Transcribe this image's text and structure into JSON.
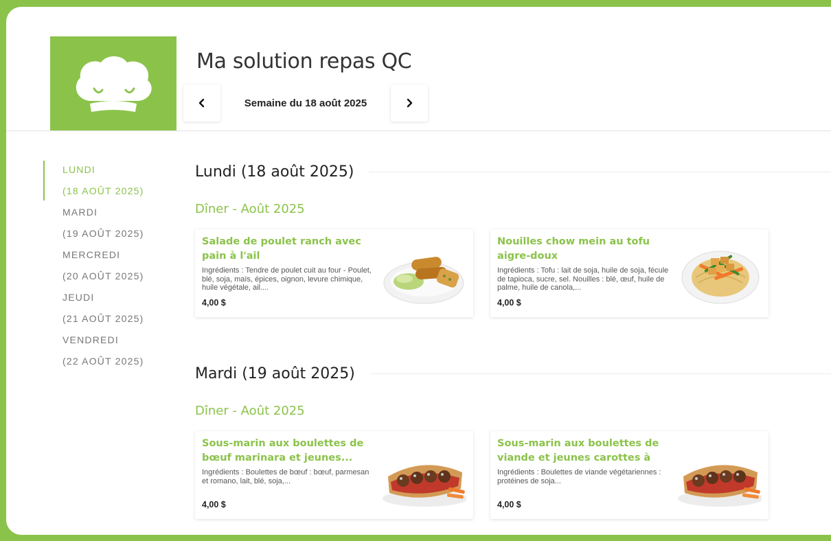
{
  "app": {
    "title": "Ma solution repas QC",
    "logo_icon": "chef-hat-icon"
  },
  "week_nav": {
    "label": "Semaine du 18 août 2025",
    "prev_icon": "chevron-left-icon",
    "next_icon": "chevron-right-icon"
  },
  "sidebar": {
    "items": [
      {
        "day": "LUNDI",
        "date": "(18 AOÛT 2025)",
        "active": true
      },
      {
        "day": "MARDI",
        "date": "(19 AOÛT 2025)",
        "active": false
      },
      {
        "day": "MERCREDI",
        "date": "(20 AOÛT 2025)",
        "active": false
      },
      {
        "day": "JEUDI",
        "date": "(21 AOÛT 2025)",
        "active": false
      },
      {
        "day": "VENDREDI",
        "date": "(22 AOÛT 2025)",
        "active": false
      }
    ]
  },
  "days": [
    {
      "heading": "Lundi (18 août 2025)",
      "meal": "Dîner - Août 2025",
      "cards": [
        {
          "title": "Salade de poulet ranch avec pain à l'ail",
          "ingredients": "Ingrédients : Tendre de poulet cuit au four - Poulet, blé, soja, maïs, épices, oignon, levure chimique, huile végétale, ail....",
          "price": "4,00 $",
          "image": "chicken-salad-image"
        },
        {
          "title": "Nouilles chow mein au tofu aigre-doux",
          "ingredients": "Ingrédients : Tofu : lait de soja, huile de soja, fécule de tapioca, sucre, sel. Nouilles : blé, œuf, huile de palme, huile de canola,...",
          "price": "4,00 $",
          "image": "tofu-noodles-image"
        }
      ]
    },
    {
      "heading": "Mardi (19 août 2025)",
      "meal": "Dîner - Août 2025",
      "cards": [
        {
          "title": "Sous-marin aux boulettes de bœuf marinara et jeunes...",
          "ingredients": "Ingrédients : Boulettes de bœuf : bœuf, parmesan et romano, lait, blé, soja,...",
          "price": "4,00 $",
          "image": "meatball-sub-image"
        },
        {
          "title": "Sous-marin aux boulettes de viande et jeunes carottes à la...",
          "ingredients": "Ingrédients : Boulettes de viande végétariennes : protéines de soja...",
          "price": "4,00 $",
          "image": "veggie-meatball-sub-image"
        }
      ]
    }
  ],
  "colors": {
    "accent": "#8bc34a",
    "text": "#222222"
  }
}
